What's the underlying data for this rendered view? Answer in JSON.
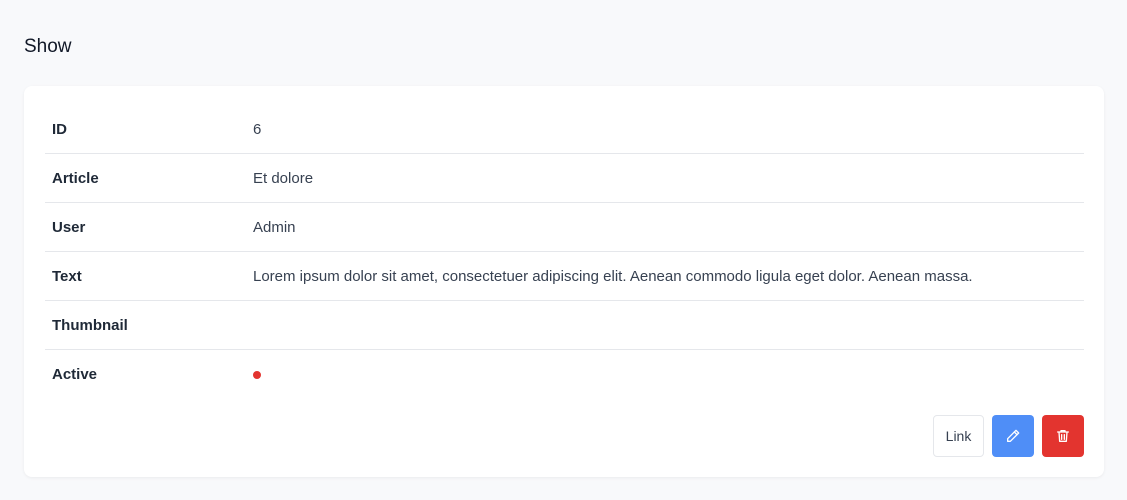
{
  "page": {
    "title": "Show"
  },
  "fields": [
    {
      "label": "ID",
      "value": "6"
    },
    {
      "label": "Article",
      "value": "Et dolore"
    },
    {
      "label": "User",
      "value": "Admin"
    },
    {
      "label": "Text",
      "value": "Lorem ipsum dolor sit amet, consectetuer adipiscing elit. Aenean commodo ligula eget dolor. Aenean massa."
    },
    {
      "label": "Thumbnail",
      "value": ""
    },
    {
      "label": "Active",
      "value": ""
    }
  ],
  "active_status": {
    "active": false,
    "color": "#e3342f"
  },
  "actions": {
    "link_label": "Link",
    "edit_icon": "pencil-icon",
    "delete_icon": "trash-icon",
    "edit_color": "#4f8ef7",
    "delete_color": "#e3342f"
  }
}
